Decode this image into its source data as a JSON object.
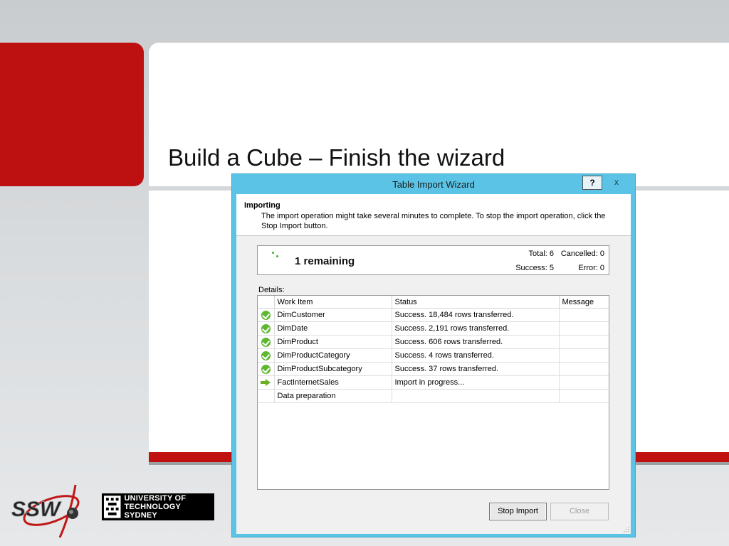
{
  "slide": {
    "title": "Build a Cube – Finish the wizard"
  },
  "logos": {
    "ssw": "SSW",
    "uts_line1": "UNIVERSITY OF",
    "uts_line2": "TECHNOLOGY SYDNEY"
  },
  "dialog": {
    "title": "Table Import Wizard",
    "help_label": "?",
    "close_label": "x",
    "header_title": "Importing",
    "header_desc": "The import operation might take several minutes to complete. To stop the import operation, click the Stop Import button.",
    "remaining": "1 remaining",
    "stats": {
      "total": "Total: 6",
      "cancelled": "Cancelled: 0",
      "success": "Success: 5",
      "error": "Error: 0"
    },
    "details_label": "Details:",
    "columns": [
      "Work Item",
      "Status",
      "Message"
    ],
    "rows": [
      {
        "icon": "success-check-icon",
        "item": "DimCustomer",
        "status": "Success. 18,484 rows transferred.",
        "message": ""
      },
      {
        "icon": "success-check-icon",
        "item": "DimDate",
        "status": "Success. 2,191 rows transferred.",
        "message": ""
      },
      {
        "icon": "success-check-icon",
        "item": "DimProduct",
        "status": "Success. 606 rows transferred.",
        "message": ""
      },
      {
        "icon": "success-check-icon",
        "item": "DimProductCategory",
        "status": "Success. 4 rows transferred.",
        "message": ""
      },
      {
        "icon": "success-check-icon",
        "item": "DimProductSubcategory",
        "status": "Success. 37 rows transferred.",
        "message": ""
      },
      {
        "icon": "in-progress-arrow-icon",
        "item": "FactInternetSales",
        "status": "Import in progress...",
        "message": ""
      },
      {
        "icon": "",
        "item": "Data preparation",
        "status": "",
        "message": ""
      }
    ],
    "stop_button": "Stop Import",
    "close_button": "Close"
  },
  "colors": {
    "slide_red": "#bd1010",
    "dialog_frame": "#5bc4e6",
    "success_green": "#5cb82e",
    "progress_arrow": "#6ab023"
  }
}
